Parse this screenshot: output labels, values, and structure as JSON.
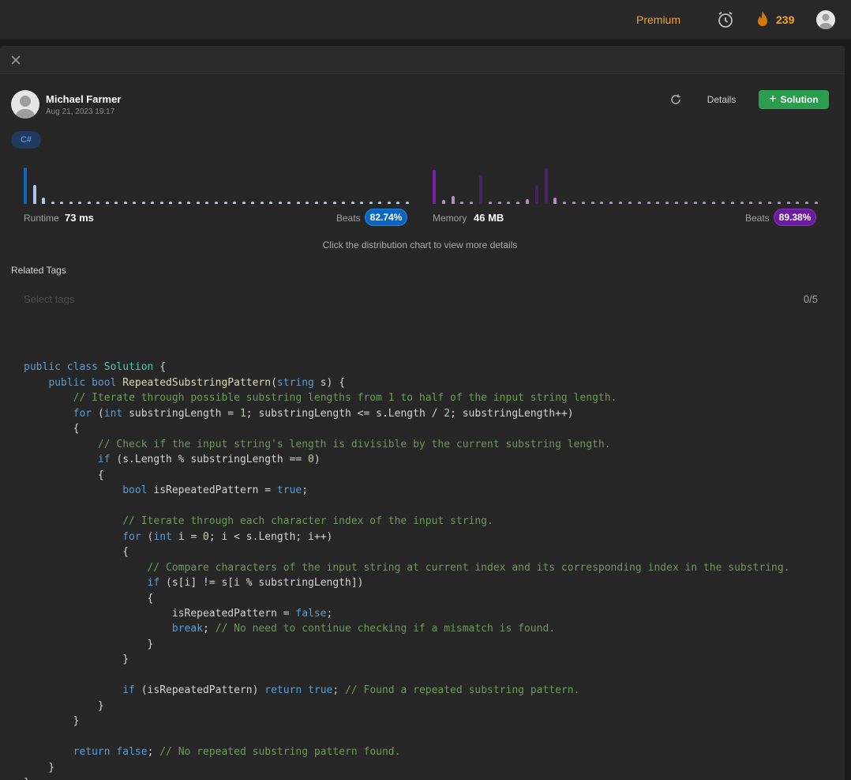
{
  "nav": {
    "premium_label": "Premium",
    "streak_count": "239"
  },
  "submission": {
    "author_name": "Michael Farmer",
    "date": "Aug 21, 2023 19:17",
    "details_label": "Details",
    "solution_label": "Solution",
    "language": "C#"
  },
  "runtime": {
    "label": "Runtime",
    "value": "73 ms",
    "beats_label": "Beats",
    "beats": "82.74%",
    "distribution": [
      1.0,
      0.52,
      0.17,
      0.07,
      0.07,
      0.07,
      0.07,
      0.07,
      0.07,
      0.07,
      0.07,
      0.07,
      0.07,
      0.07,
      0.07,
      0.07,
      0.07,
      0.07,
      0.07,
      0.07,
      0.07,
      0.07,
      0.07,
      0.07,
      0.07,
      0.07,
      0.07,
      0.07,
      0.07,
      0.07,
      0.07,
      0.07,
      0.07,
      0.07,
      0.07,
      0.07,
      0.07,
      0.07,
      0.07,
      0.07,
      0.07,
      0.07,
      0.07
    ],
    "highlight_index": 0,
    "color": "#0a66c2",
    "muted_color": "#a9c7e8"
  },
  "memory": {
    "label": "Memory",
    "value": "46 MB",
    "beats_label": "Beats",
    "beats": "89.38%",
    "distribution": [
      0.93,
      0.1,
      0.22,
      0.07,
      0.07,
      0.79,
      0.07,
      0.07,
      0.07,
      0.07,
      0.12,
      0.53,
      0.98,
      0.17,
      0.07,
      0.07,
      0.07,
      0.07,
      0.07,
      0.07,
      0.07,
      0.07,
      0.07,
      0.07,
      0.07,
      0.07,
      0.07,
      0.07,
      0.07,
      0.07,
      0.07,
      0.07,
      0.07,
      0.07,
      0.07,
      0.07,
      0.07,
      0.07,
      0.07,
      0.07,
      0.07,
      0.07
    ],
    "highlight_index": 0,
    "color": "#7a1fa8",
    "muted_color": "#b28cc7",
    "dark_color": "#4a2266"
  },
  "hint": "Click the distribution chart to view more details",
  "tags": {
    "title": "Related Tags",
    "placeholder": "Select tags",
    "count": "0/5"
  },
  "code": [
    [],
    [
      [
        "kw",
        "public "
      ],
      [
        "kw",
        "class "
      ],
      [
        "ty",
        "Solution"
      ],
      [
        "vr",
        " {"
      ]
    ],
    [
      [
        "vr",
        "    "
      ],
      [
        "kw",
        "public "
      ],
      [
        "kw",
        "bool "
      ],
      [
        "fn",
        "RepeatedSubstringPattern"
      ],
      [
        "vr",
        "("
      ],
      [
        "kw",
        "string "
      ],
      [
        "vr",
        "s) {"
      ]
    ],
    [
      [
        "vr",
        "        "
      ],
      [
        "cm",
        "// Iterate through possible substring lengths from 1 to half of the input string length."
      ]
    ],
    [
      [
        "vr",
        "        "
      ],
      [
        "kw",
        "for "
      ],
      [
        "vr",
        "("
      ],
      [
        "kw",
        "int "
      ],
      [
        "vr",
        "substringLength = "
      ],
      [
        "nm",
        "1"
      ],
      [
        "vr",
        "; substringLength <= s.Length / "
      ],
      [
        "nm",
        "2"
      ],
      [
        "vr",
        "; substringLength++)"
      ]
    ],
    [
      [
        "vr",
        "        {"
      ]
    ],
    [
      [
        "vr",
        "            "
      ],
      [
        "cm",
        "// Check if the input string's length is divisible by the current substring length."
      ]
    ],
    [
      [
        "vr",
        "            "
      ],
      [
        "kw",
        "if "
      ],
      [
        "vr",
        "(s.Length % substringLength == "
      ],
      [
        "nm",
        "0"
      ],
      [
        "vr",
        ")"
      ]
    ],
    [
      [
        "vr",
        "            {"
      ]
    ],
    [
      [
        "vr",
        "                "
      ],
      [
        "kw",
        "bool "
      ],
      [
        "vr",
        "isRepeatedPattern = "
      ],
      [
        "kw",
        "true"
      ],
      [
        "vr",
        ";"
      ]
    ],
    [],
    [
      [
        "vr",
        "                "
      ],
      [
        "cm",
        "// Iterate through each character index of the input string."
      ]
    ],
    [
      [
        "vr",
        "                "
      ],
      [
        "kw",
        "for "
      ],
      [
        "vr",
        "("
      ],
      [
        "kw",
        "int "
      ],
      [
        "vr",
        "i = "
      ],
      [
        "nm",
        "0"
      ],
      [
        "vr",
        "; i < s.Length; i++)"
      ]
    ],
    [
      [
        "vr",
        "                {"
      ]
    ],
    [
      [
        "vr",
        "                    "
      ],
      [
        "cm",
        "// Compare characters of the input string at current index and its corresponding index in the substring."
      ]
    ],
    [
      [
        "vr",
        "                    "
      ],
      [
        "kw",
        "if "
      ],
      [
        "vr",
        "(s[i] != s[i % substringLength])"
      ]
    ],
    [
      [
        "vr",
        "                    {"
      ]
    ],
    [
      [
        "vr",
        "                        isRepeatedPattern = "
      ],
      [
        "kw",
        "false"
      ],
      [
        "vr",
        ";"
      ]
    ],
    [
      [
        "vr",
        "                        "
      ],
      [
        "kw",
        "break"
      ],
      [
        "vr",
        "; "
      ],
      [
        "cm",
        "// No need to continue checking if a mismatch is found."
      ]
    ],
    [
      [
        "vr",
        "                    }"
      ]
    ],
    [
      [
        "vr",
        "                }"
      ]
    ],
    [],
    [
      [
        "vr",
        "                "
      ],
      [
        "kw",
        "if "
      ],
      [
        "vr",
        "(isRepeatedPattern) "
      ],
      [
        "kw",
        "return "
      ],
      [
        "kw",
        "true"
      ],
      [
        "vr",
        "; "
      ],
      [
        "cm",
        "// Found a repeated substring pattern."
      ]
    ],
    [
      [
        "vr",
        "            }"
      ]
    ],
    [
      [
        "vr",
        "        }"
      ]
    ],
    [],
    [
      [
        "vr",
        "        "
      ],
      [
        "kw",
        "return "
      ],
      [
        "kw",
        "false"
      ],
      [
        "vr",
        "; "
      ],
      [
        "cm",
        "// No repeated substring pattern found."
      ]
    ],
    [
      [
        "vr",
        "    }"
      ]
    ],
    [
      [
        "vr",
        "}"
      ]
    ]
  ]
}
